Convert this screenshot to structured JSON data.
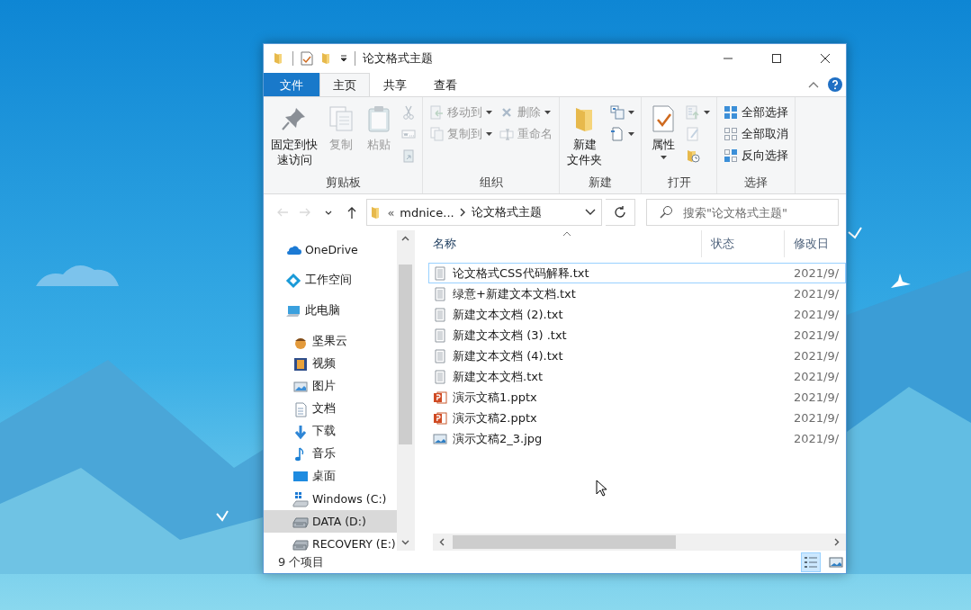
{
  "window": {
    "title": "论文格式主题"
  },
  "ribbon": {
    "tabs": [
      {
        "label": "文件",
        "kind": "file",
        "selected": false
      },
      {
        "label": "主页",
        "kind": "tab",
        "selected": true
      },
      {
        "label": "共享",
        "kind": "tab",
        "selected": false
      },
      {
        "label": "查看",
        "kind": "tab",
        "selected": false
      }
    ],
    "groups": [
      {
        "label": "剪贴板",
        "columns": [
          {
            "kind": "large",
            "commands": [
              {
                "kind": "pin",
                "lines": [
                  "固定到快",
                  "速访问"
                ],
                "disabled": false,
                "dropdown": false
              }
            ]
          },
          {
            "kind": "large",
            "commands": [
              {
                "kind": "copy",
                "lines": [
                  "复制"
                ],
                "disabled": true,
                "dropdown": false
              }
            ]
          },
          {
            "kind": "large",
            "commands": [
              {
                "kind": "paste",
                "lines": [
                  "粘贴"
                ],
                "disabled": true,
                "dropdown": false
              }
            ]
          },
          {
            "kind": "stack",
            "commands": [
              {
                "kind": "cut",
                "disabled": true,
                "dropdown": false
              },
              {
                "kind": "copy-path",
                "disabled": true,
                "dropdown": false
              },
              {
                "kind": "paste-shortcut",
                "disabled": true,
                "dropdown": false
              }
            ]
          }
        ]
      },
      {
        "label": "组织",
        "columns": [
          {
            "kind": "stack",
            "commands": [
              {
                "kind": "move-to",
                "lines": [
                  "移动到"
                ],
                "disabled": true,
                "dropdown": true
              },
              {
                "kind": "copy-to",
                "lines": [
                  "复制到"
                ],
                "disabled": true,
                "dropdown": true
              }
            ]
          },
          {
            "kind": "stack",
            "commands": [
              {
                "kind": "delete",
                "lines": [
                  "删除"
                ],
                "disabled": true,
                "dropdown": true
              },
              {
                "kind": "rename",
                "lines": [
                  "重命名"
                ],
                "disabled": true,
                "dropdown": false
              }
            ]
          }
        ]
      },
      {
        "label": "新建",
        "columns": [
          {
            "kind": "large",
            "commands": [
              {
                "kind": "new-folder",
                "lines": [
                  "新建",
                  "文件夹"
                ],
                "disabled": false,
                "dropdown": false
              }
            ]
          },
          {
            "kind": "stack",
            "commands": [
              {
                "kind": "new-item",
                "disabled": false,
                "dropdown": true
              },
              {
                "kind": "easy-access",
                "disabled": false,
                "dropdown": true
              }
            ]
          }
        ]
      },
      {
        "label": "打开",
        "columns": [
          {
            "kind": "large",
            "commands": [
              {
                "kind": "properties",
                "lines": [
                  "属性"
                ],
                "disabled": false,
                "dropdown": true
              }
            ]
          },
          {
            "kind": "stack",
            "commands": [
              {
                "kind": "open",
                "disabled": true,
                "dropdown": true
              },
              {
                "kind": "edit",
                "disabled": true,
                "dropdown": false
              },
              {
                "kind": "history",
                "disabled": false,
                "dropdown": false
              }
            ]
          }
        ]
      },
      {
        "label": "选择",
        "columns": [
          {
            "kind": "stack",
            "commands": [
              {
                "kind": "select-all",
                "lines": [
                  "全部选择"
                ],
                "disabled": false,
                "dropdown": false
              },
              {
                "kind": "select-none",
                "lines": [
                  "全部取消"
                ],
                "disabled": false,
                "dropdown": false
              },
              {
                "kind": "invert",
                "lines": [
                  "反向选择"
                ],
                "disabled": false,
                "dropdown": false
              }
            ]
          }
        ]
      }
    ]
  },
  "nav_buttons": [
    {
      "kind": "back",
      "disabled": true
    },
    {
      "kind": "forward",
      "disabled": true
    },
    {
      "kind": "recent",
      "disabled": false
    },
    {
      "kind": "up",
      "disabled": false
    }
  ],
  "address": {
    "overflow": "«",
    "crumbs": [
      "mdnice...",
      "论文格式主题"
    ]
  },
  "search": {
    "placeholder": "搜索\"论文格式主题\""
  },
  "sidebar": {
    "items": [
      {
        "label": "OneDrive",
        "kind": "onedrive",
        "selected": false
      },
      {
        "label": "工作空间",
        "kind": "workspace",
        "selected": false
      },
      {
        "label": "此电脑",
        "kind": "pc",
        "selected": false,
        "children": [
          {
            "label": "坚果云",
            "kind": "nutstore",
            "selected": false
          },
          {
            "label": "视频",
            "kind": "video",
            "selected": false
          },
          {
            "label": "图片",
            "kind": "pictures",
            "selected": false
          },
          {
            "label": "文档",
            "kind": "documents",
            "selected": false
          },
          {
            "label": "下载",
            "kind": "downloads",
            "selected": false
          },
          {
            "label": "音乐",
            "kind": "music",
            "selected": false
          },
          {
            "label": "桌面",
            "kind": "desktop",
            "selected": false
          },
          {
            "label": "Windows (C:)",
            "kind": "system-drive",
            "selected": false
          },
          {
            "label": "DATA (D:)",
            "kind": "drive",
            "selected": true
          },
          {
            "label": "RECOVERY (E:)",
            "kind": "drive",
            "selected": false
          }
        ]
      }
    ]
  },
  "file_list": {
    "columns": [
      {
        "label": "名称",
        "sorted": true
      },
      {
        "label": "状态",
        "sorted": false
      },
      {
        "label": "修改日",
        "sorted": false
      }
    ],
    "rows": [
      {
        "name": "论文格式CSS代码解释.txt",
        "kind": "txt",
        "date": "2021/9/",
        "focused": true
      },
      {
        "name": "绿意+新建文本文档.txt",
        "kind": "txt",
        "date": "2021/9/",
        "focused": false
      },
      {
        "name": "新建文本文档 (2).txt",
        "kind": "txt",
        "date": "2021/9/",
        "focused": false
      },
      {
        "name": "新建文本文档 (3) .txt",
        "kind": "txt",
        "date": "2021/9/",
        "focused": false
      },
      {
        "name": "新建文本文档 (4).txt",
        "kind": "txt",
        "date": "2021/9/",
        "focused": false
      },
      {
        "name": "新建文本文档.txt",
        "kind": "txt",
        "date": "2021/9/",
        "focused": false
      },
      {
        "name": "演示文稿1.pptx",
        "kind": "pptx",
        "date": "2021/9/",
        "focused": false
      },
      {
        "name": "演示文稿2.pptx",
        "kind": "pptx",
        "date": "2021/9/",
        "focused": false
      },
      {
        "name": "演示文稿2_3.jpg",
        "kind": "jpg",
        "date": "2021/9/",
        "focused": false
      }
    ]
  },
  "status_bar": {
    "item_count": "9 个项目",
    "views": [
      {
        "kind": "details",
        "selected": true
      },
      {
        "kind": "large-icons",
        "selected": false
      }
    ]
  }
}
